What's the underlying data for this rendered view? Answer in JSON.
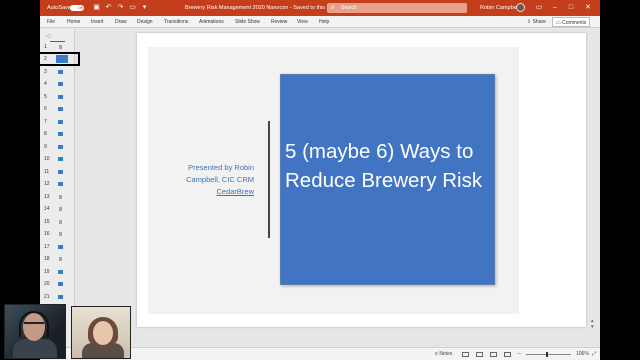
{
  "titlebar": {
    "autosave_label": "AutoSave",
    "autosave_state": "Off",
    "title": "Brewery Risk Management 2020 Nanocon  -  Saved to this PC",
    "search_placeholder": "Search",
    "user_name": "Robin Campbell"
  },
  "ribbon": {
    "tabs": [
      "File",
      "Home",
      "Insert",
      "Draw",
      "Design",
      "Transitions",
      "Animations",
      "Slide Show",
      "Review",
      "View",
      "Help"
    ],
    "share": "Share",
    "comments": "Comments"
  },
  "thumbnails": {
    "active": 2,
    "slides": [
      "1",
      "2",
      "3",
      "4",
      "5",
      "6",
      "7",
      "8",
      "9",
      "10",
      "11",
      "12",
      "13",
      "14",
      "15",
      "16",
      "17",
      "18",
      "19",
      "20",
      "21"
    ]
  },
  "slide": {
    "presented_by": "Presented by Robin Campbell, CIC CRM",
    "brand": "CedarBrew",
    "title": "5 (maybe 6) Ways to Reduce Brewery Risk"
  },
  "statusbar": {
    "notes": "Notes",
    "zoom": "106%"
  },
  "colors": {
    "accent": "#c43e1c",
    "slide_blue": "#4175c4",
    "text_blue": "#3e74b3"
  }
}
